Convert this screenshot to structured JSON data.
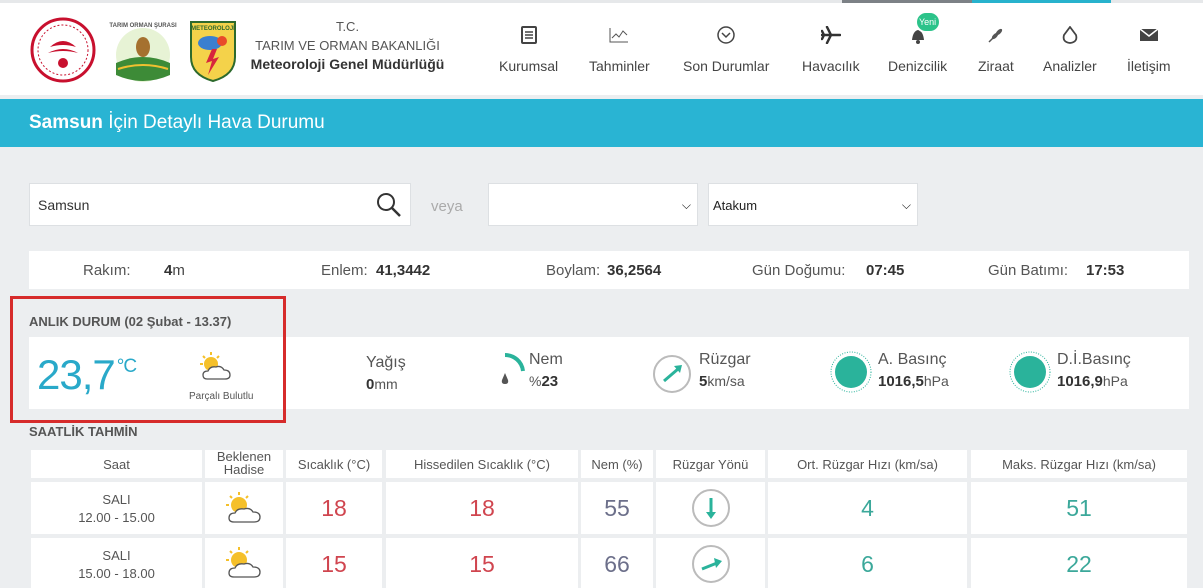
{
  "header": {
    "org_line1": "T.C.",
    "org_line2": "TARIM VE ORMAN BAKANLIĞI",
    "org_line3": "Meteoroloji Genel Müdürlüğü",
    "logo2_text": "TARIM ORMAN ŞURASI",
    "logo3_text": "METEOROLOJİ",
    "nav": [
      {
        "label": "Kurumsal",
        "icon": "document-icon"
      },
      {
        "label": "Tahminler",
        "icon": "chart-icon"
      },
      {
        "label": "Son Durumlar",
        "icon": "chevron-circle-icon"
      },
      {
        "label": "Havacılık",
        "icon": "airplane-icon"
      },
      {
        "label": "Denizcilik",
        "icon": "bell-icon",
        "badge": "Yeni"
      },
      {
        "label": "Ziraat",
        "icon": "wheat-icon"
      },
      {
        "label": "Analizler",
        "icon": "drop-icon"
      },
      {
        "label": "İletişim",
        "icon": "envelope-icon"
      }
    ]
  },
  "title": {
    "city": "Samsun",
    "rest": "İçin Detaylı Hava Durumu"
  },
  "search": {
    "value": "Samsun",
    "or_label": "veya",
    "select1": "",
    "select2": "Atakum"
  },
  "info": {
    "rakim_label": "Rakım:",
    "rakim_value": "4",
    "rakim_unit": "m",
    "enlem_label": "Enlem:",
    "enlem_value": "41,3442",
    "boylam_label": "Boylam:",
    "boylam_value": "36,2564",
    "dogum_label": "Gün Doğumu:",
    "dogum_value": "07:45",
    "batim_label": "Gün Batımı:",
    "batim_value": "17:53"
  },
  "current": {
    "title": "ANLIK DURUM",
    "date": "(02 Şubat - 13.37)",
    "temp": "23,7",
    "temp_unit": "°C",
    "condition": "Parçalı Bulutlu",
    "yagis_label": "Yağış",
    "yagis_value": "0",
    "yagis_unit": "mm",
    "nem_label": "Nem",
    "nem_prefix": "%",
    "nem_value": "23",
    "ruzgar_label": "Rüzgar",
    "ruzgar_value": "5",
    "ruzgar_unit": "km/sa",
    "abasinc_label": "A. Basınç",
    "abasinc_value": "1016,5",
    "abasinc_unit": "hPa",
    "dibasinc_label": "D.İ.Basınç",
    "dibasinc_value": "1016,9",
    "dibasinc_unit": "hPa",
    "colors": {
      "accent": "#29b4d3",
      "gauge": "#2ab39b",
      "highlight": "#d62b2b"
    }
  },
  "hourly": {
    "title": "SAATLİK TAHMİN",
    "headers": [
      "Saat",
      "Beklenen Hadise",
      "Sıcaklık (°C)",
      "Hissedilen Sıcaklık (°C)",
      "Nem (%)",
      "Rüzgar Yönü",
      "Ort. Rüzgar Hızı (km/sa)",
      "Maks. Rüzgar Hızı (km/sa)"
    ],
    "rows": [
      {
        "day": "SALI",
        "range": "12.00 - 15.00",
        "icon": "partly-cloudy-icon",
        "temp": "18",
        "feels": "18",
        "humidity": "55",
        "wind_dir": "south",
        "wind_avg": "4",
        "wind_max": "51"
      },
      {
        "day": "SALI",
        "range": "15.00 - 18.00",
        "icon": "partly-cloudy-icon",
        "temp": "15",
        "feels": "15",
        "humidity": "66",
        "wind_dir": "northeast",
        "wind_avg": "6",
        "wind_max": "22"
      }
    ]
  }
}
